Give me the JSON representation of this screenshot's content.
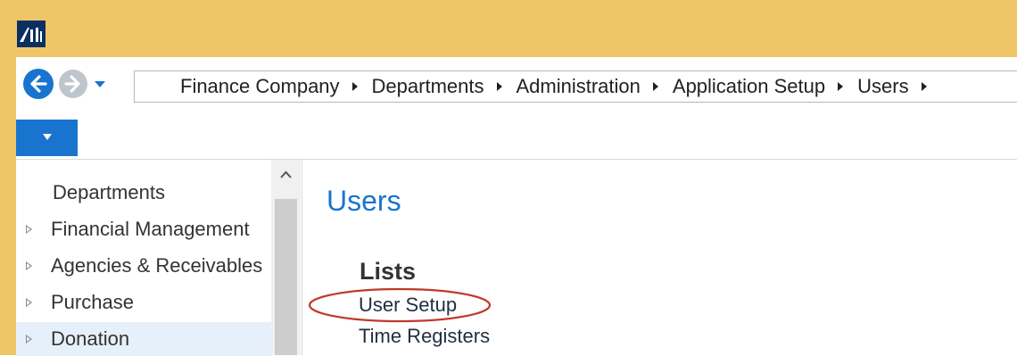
{
  "nav": {
    "breadcrumbs": [
      "Finance Company",
      "Departments",
      "Administration",
      "Application Setup",
      "Users"
    ]
  },
  "sidebar": {
    "title": "Departments",
    "items": [
      {
        "label": "Financial Management"
      },
      {
        "label": "Agencies & Receivables"
      },
      {
        "label": "Purchase"
      },
      {
        "label": "Donation"
      }
    ]
  },
  "main": {
    "title": "Users",
    "section": "Lists",
    "links": [
      "User Setup",
      "Time Registers"
    ]
  },
  "colors": {
    "title_bar": "#EFC667",
    "accent": "#1874CE",
    "highlight_ring": "#C0392B"
  },
  "icons": [
    "app-logo-icon",
    "back-arrow-icon",
    "forward-arrow-icon",
    "history-dropdown-icon",
    "ribbon-toggle-icon",
    "expand-triangle-icon",
    "scroll-up-icon"
  ]
}
